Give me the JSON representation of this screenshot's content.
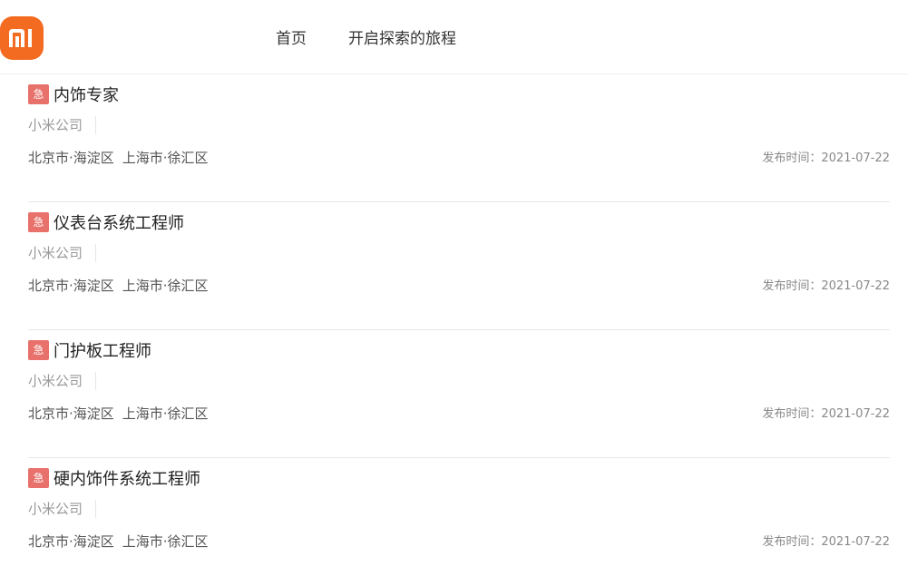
{
  "header": {
    "logo": {
      "icon": "mi-logo-icon",
      "color": "#f36b21"
    },
    "nav": [
      {
        "label": "首页"
      },
      {
        "label": "开启探索的旅程"
      }
    ]
  },
  "jobs": [
    {
      "badge": "急",
      "title": "内饰专家",
      "company": "小米公司",
      "locations": [
        "北京市·海淀区",
        "上海市·徐汇区"
      ],
      "date": "发布时间：2021-07-22"
    },
    {
      "badge": "急",
      "title": "仪表台系统工程师",
      "company": "小米公司",
      "locations": [
        "北京市·海淀区",
        "上海市·徐汇区"
      ],
      "date": "发布时间：2021-07-22"
    },
    {
      "badge": "急",
      "title": "门护板工程师",
      "company": "小米公司",
      "locations": [
        "北京市·海淀区",
        "上海市·徐汇区"
      ],
      "date": "发布时间：2021-07-22"
    },
    {
      "badge": "急",
      "title": "硬内饰件系统工程师",
      "company": "小米公司",
      "locations": [
        "北京市·海淀区",
        "上海市·徐汇区"
      ],
      "date": "发布时间：2021-07-22"
    }
  ]
}
